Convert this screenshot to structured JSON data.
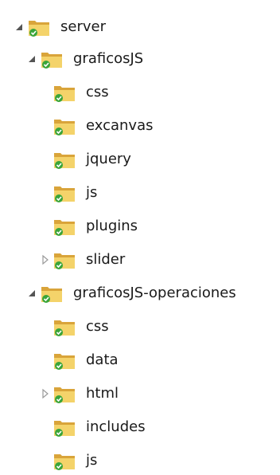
{
  "tree": {
    "root": {
      "label": "server",
      "expanded": true,
      "children": [
        {
          "label": "graficosJS",
          "expanded": true,
          "children": [
            {
              "label": "css"
            },
            {
              "label": "excanvas"
            },
            {
              "label": "jquery"
            },
            {
              "label": "js"
            },
            {
              "label": "plugins"
            },
            {
              "label": "slider",
              "collapsed_with_children": true
            }
          ]
        },
        {
          "label": "graficosJS-operaciones",
          "expanded": true,
          "children": [
            {
              "label": "css"
            },
            {
              "label": "data"
            },
            {
              "label": "html",
              "collapsed_with_children": true
            },
            {
              "label": "includes"
            },
            {
              "label": "js"
            }
          ]
        }
      ]
    }
  },
  "colors": {
    "folder_back": "#d9a43a",
    "folder_front": "#f4d36a",
    "sync_badge": "#3aa53a",
    "arrow_expanded": "#555555",
    "arrow_collapsed": "#9a9a9a"
  }
}
